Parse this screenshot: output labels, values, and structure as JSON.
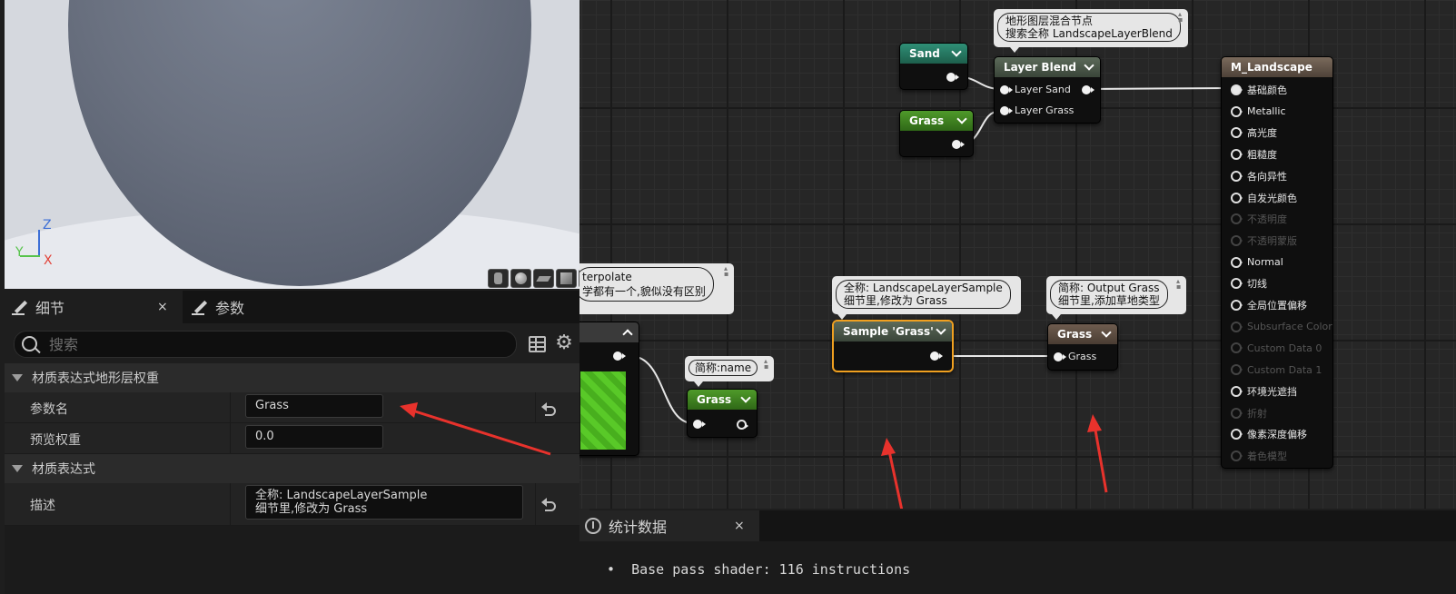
{
  "viewport": {
    "axes": {
      "z": "Z",
      "y": "Y",
      "x": "X"
    },
    "preview_shapes": [
      "cylinder-icon",
      "sphere-icon",
      "plane-icon",
      "cube-icon",
      "teapot-icon"
    ]
  },
  "details": {
    "tabs": [
      {
        "label": "细节",
        "icon": "pencil-icon",
        "close": "×"
      },
      {
        "label": "参数",
        "icon": "pencil-icon"
      }
    ],
    "search": {
      "placeholder": "搜索",
      "value": ""
    },
    "sections": [
      {
        "title": "材质表达式地形层权重",
        "rows": [
          {
            "name": "参数名",
            "value": "Grass"
          },
          {
            "name": "预览权重",
            "value": "0.0"
          }
        ]
      },
      {
        "title": "材质表达式",
        "rows": [
          {
            "name": "描述",
            "value_line1": "全称: LandscapeLayerSample",
            "value_line2": "细节里,修改为 Grass"
          }
        ]
      }
    ]
  },
  "graph": {
    "comments": {
      "layer_blend": {
        "line1": "地形图层混合节点",
        "line2": "搜索全称 LandscapeLayerBlend"
      },
      "interpolate": {
        "line1": "terpolate",
        "line2": "学都有一个,貌似没有区别"
      },
      "name_short": {
        "line1": "简称:name"
      },
      "sample_full": {
        "line1": "全称: LandscapeLayerSample",
        "line2": "细节里,修改为 Grass"
      },
      "output_short": {
        "line1": "简称: Output Grass",
        "line2": "细节里,添加草地类型"
      }
    },
    "nodes": {
      "sand": {
        "title": "Sand"
      },
      "grass_top": {
        "title": "Grass"
      },
      "layer_blend": {
        "title": "Layer Blend",
        "inputs": [
          "Layer Sand",
          "Layer Grass"
        ]
      },
      "grass_small": {
        "title": "Grass"
      },
      "sample": {
        "title": "Sample 'Grass'"
      },
      "grass_output": {
        "title": "Grass",
        "inputs": [
          "Grass"
        ]
      },
      "m_landscape": {
        "title": "M_Landscape",
        "pins": [
          {
            "label": "基础颜色",
            "enabled": true,
            "connected": true
          },
          {
            "label": "Metallic",
            "enabled": true
          },
          {
            "label": "高光度",
            "enabled": true
          },
          {
            "label": "粗糙度",
            "enabled": true
          },
          {
            "label": "各向异性",
            "enabled": true
          },
          {
            "label": "自发光颜色",
            "enabled": true
          },
          {
            "label": "不透明度",
            "enabled": false
          },
          {
            "label": "不透明蒙版",
            "enabled": false
          },
          {
            "label": "Normal",
            "enabled": true
          },
          {
            "label": "切线",
            "enabled": true
          },
          {
            "label": "全局位置偏移",
            "enabled": true
          },
          {
            "label": "Subsurface Color",
            "enabled": false
          },
          {
            "label": "Custom Data 0",
            "enabled": false
          },
          {
            "label": "Custom Data 1",
            "enabled": false
          },
          {
            "label": "环境光遮挡",
            "enabled": true
          },
          {
            "label": "折射",
            "enabled": false
          },
          {
            "label": "像素深度偏移",
            "enabled": true
          },
          {
            "label": "着色模型",
            "enabled": false
          }
        ]
      }
    }
  },
  "stats": {
    "tab_label": "统计数据",
    "close": "×",
    "lines": [
      "Base pass shader: 116 instructions"
    ]
  },
  "colors": {
    "annotation_arrow": "#e8322c",
    "selected_node": "#f0a020"
  }
}
